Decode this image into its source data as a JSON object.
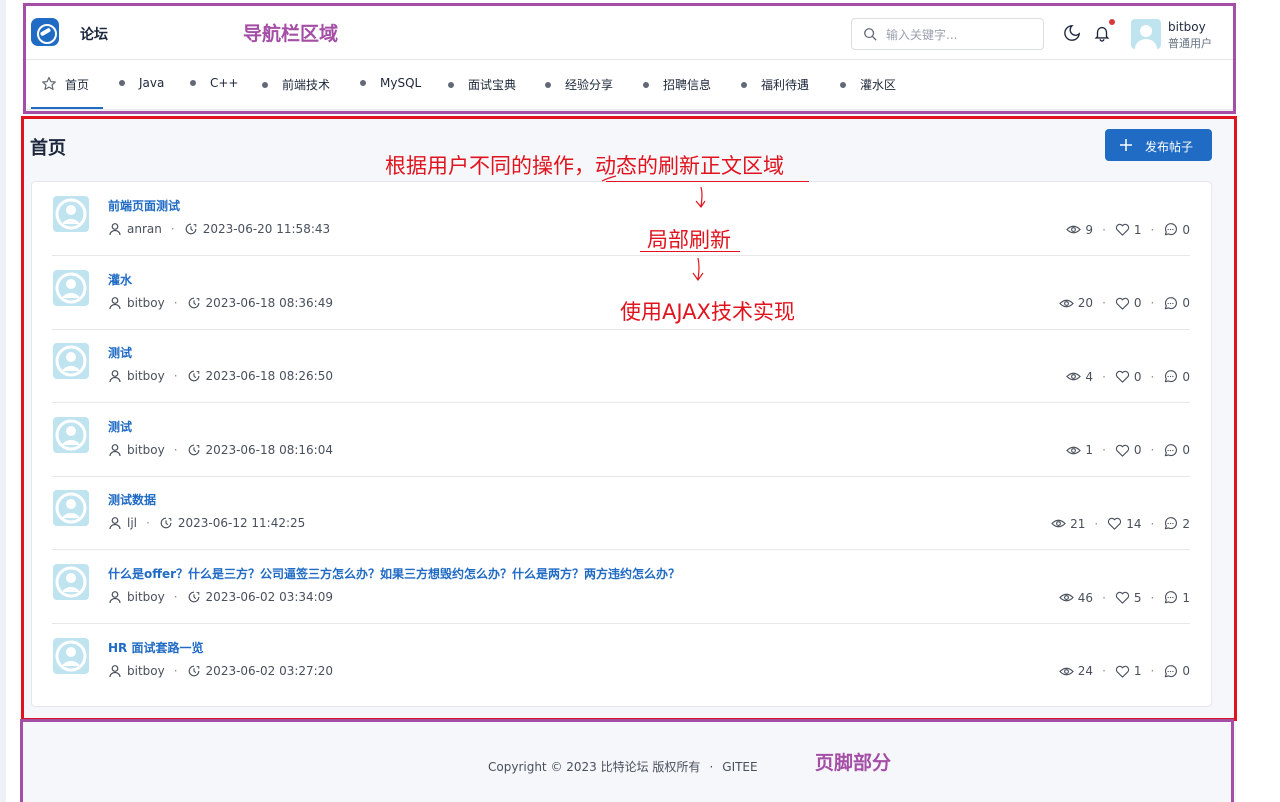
{
  "header": {
    "brand": "论坛",
    "search_placeholder": "输入关键字...",
    "user": {
      "name": "bitboy",
      "role": "普通用户"
    }
  },
  "nav": {
    "items": [
      {
        "label": "首页",
        "icon": "star-icon",
        "active": true
      },
      {
        "label": "Java"
      },
      {
        "label": "C++"
      },
      {
        "label": "前端技术"
      },
      {
        "label": "MySQL"
      },
      {
        "label": "面试宝典"
      },
      {
        "label": "经验分享"
      },
      {
        "label": "招聘信息"
      },
      {
        "label": "福利待遇"
      },
      {
        "label": "灌水区"
      }
    ]
  },
  "main": {
    "title": "首页",
    "new_post_label": "发布帖子",
    "posts": [
      {
        "title": "前端页面测试",
        "author": "anran",
        "time": "2023-06-20 11:58:43",
        "views": "9",
        "likes": "1",
        "comments": "0"
      },
      {
        "title": "灌水",
        "author": "bitboy",
        "time": "2023-06-18 08:36:49",
        "views": "20",
        "likes": "0",
        "comments": "0"
      },
      {
        "title": "测试",
        "author": "bitboy",
        "time": "2023-06-18 08:26:50",
        "views": "4",
        "likes": "0",
        "comments": "0"
      },
      {
        "title": "测试",
        "author": "bitboy",
        "time": "2023-06-18 08:16:04",
        "views": "1",
        "likes": "0",
        "comments": "0"
      },
      {
        "title": "测试数据",
        "author": "ljl",
        "time": "2023-06-12 11:42:25",
        "views": "21",
        "likes": "14",
        "comments": "2"
      },
      {
        "title": "什么是offer？什么是三方？公司逼签三方怎么办？如果三方想毁约怎么办？什么是两方？两方违约怎么办？",
        "author": "bitboy",
        "time": "2023-06-02 03:34:09",
        "views": "46",
        "likes": "5",
        "comments": "1"
      },
      {
        "title": "HR 面试套路一览",
        "author": "bitboy",
        "time": "2023-06-02 03:27:20",
        "views": "24",
        "likes": "1",
        "comments": "0"
      }
    ]
  },
  "footer": {
    "copyright": "Copyright © 2023 比特论坛 版权所有",
    "link": "GITEE"
  },
  "annotations": {
    "nav_area": "导航栏区域",
    "main_refresh": "根据用户不同的操作，动态的刷新正文区域",
    "partial": "局部刷新",
    "ajax": "使用AJAX技术实现",
    "footer_area": "页脚部分"
  },
  "colors": {
    "primary": "#206bc4",
    "annotation_red": "#e0141e",
    "annotation_purple": "#a44ea6",
    "notification_dot": "#d63939"
  }
}
